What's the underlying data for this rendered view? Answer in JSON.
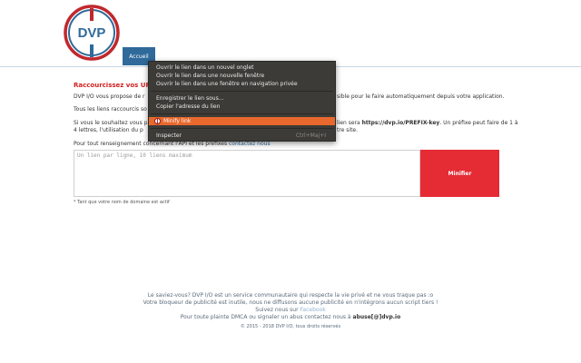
{
  "logo": {
    "text": "DVP"
  },
  "nav": {
    "home": "Accueil"
  },
  "main": {
    "title": "Raccourcissez vos URL",
    "p1_start": "DVP I/O vous propose de r",
    "p1_end": "sible pour le faire automatiquement depuis votre application.",
    "p2": "Tous les liens raccourcis so",
    "p3_a": "Si vous le souhaitez vous p",
    "p3_b": "lien sera ",
    "p3_url": "https://dvp.io/PREFIX-key",
    "p3_c": ". Un préfixe peut faire de 1 à",
    "p3_d": "4 lettres, l'utilisation du p",
    "p3_e": "tre site.",
    "p4_text": "Pour tout renseignement concernant l'API et les préfixes ",
    "p4_link": "contactez nous",
    "textarea_placeholder": "Un lien par ligne, 10 liens maximum",
    "minify_button": "Minifier",
    "note": "* Tant que votre nom de domaine est actif"
  },
  "footer": {
    "line1": "Le saviez-vous? DVP I/O est un service communautaire qui respecte la vie privé et ne vous traque pas :o",
    "line2": "Votre bloqueur de publicité est inutile, nous ne diffusons aucune publicité en n'intégrons aucun script tiers !",
    "line3_text": "Suivez nous sur ",
    "line3_link": "Facebook",
    "line4_text": "Pour toute plainte DMCA ou signaler un abus contactez nous à ",
    "line4_email": "abuse[@]dvp.io",
    "copyright": "© 2015 - 2018 DVP I/O, tous droits réservés"
  },
  "context_menu": {
    "items": [
      {
        "label": "Ouvrir le lien dans un nouvel onglet"
      },
      {
        "label": "Ouvrir le lien dans une nouvelle fenêtre"
      },
      {
        "label": "Ouvrir le lien dans une fenêtre en navigation privée"
      },
      {
        "label": "Enregistrer le lien sous..."
      },
      {
        "label": "Copier l'adresse du lien"
      },
      {
        "label": "Minify link"
      },
      {
        "label": "Inspecter",
        "shortcut": "Ctrl+Maj+I"
      }
    ]
  },
  "colors": {
    "brand_blue": "#2f6a9b",
    "brand_red": "#e52b34",
    "highlight": "#e8682d"
  }
}
